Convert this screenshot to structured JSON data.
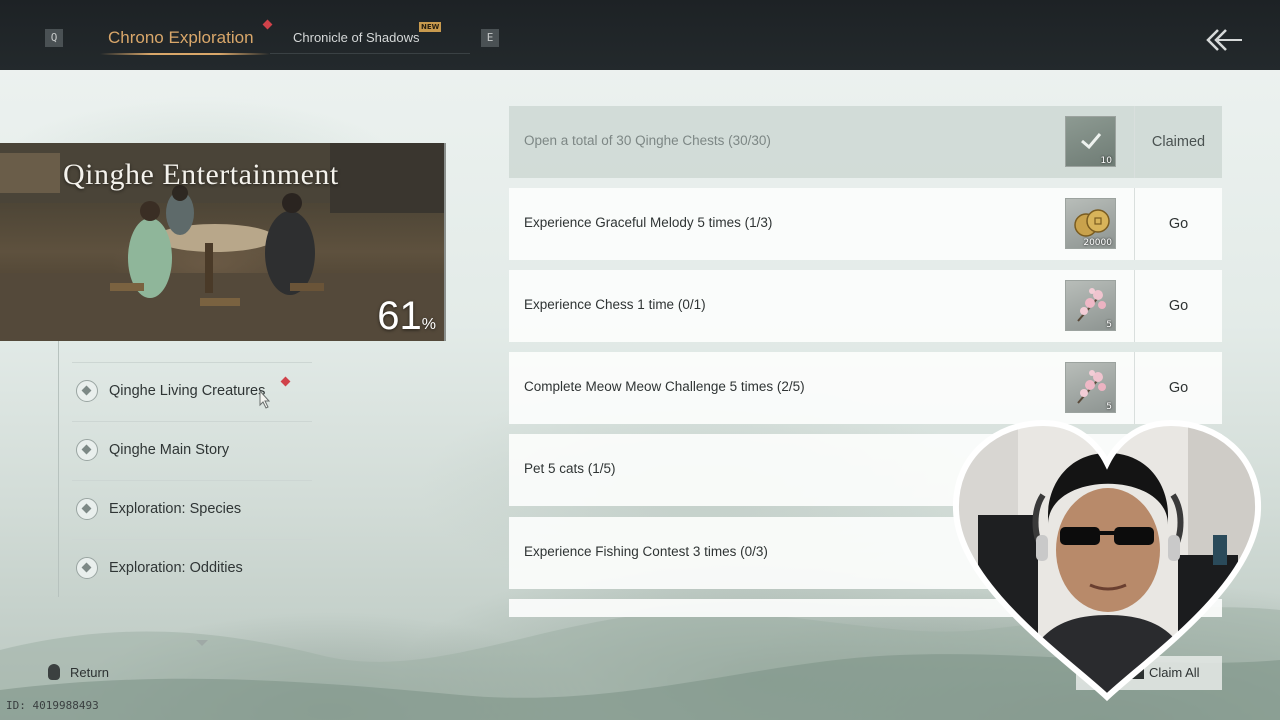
{
  "topbar": {
    "left_key": "Q",
    "right_key": "E",
    "tabs": [
      {
        "label": "Chrono Exploration",
        "active": true,
        "has_alert": true
      },
      {
        "label": "Chronicle of Shadows",
        "active": false,
        "badge": "NEW"
      }
    ],
    "back_icon": "double-chevron-back-icon"
  },
  "hero": {
    "title": "Qinghe Entertainment",
    "progress_value": "61",
    "progress_sign": "%"
  },
  "categories": [
    {
      "label": "Qinghe Living Creatures",
      "has_alert": true
    },
    {
      "label": "Qinghe Main Story",
      "has_alert": false
    },
    {
      "label": "Exploration: Species",
      "has_alert": false
    },
    {
      "label": "Exploration: Oddities",
      "has_alert": false
    }
  ],
  "tasks": [
    {
      "text": "Open a total of 30 Qinghe Chests (30/30)",
      "reward_icon": "checkmark-icon",
      "reward_qty": "10",
      "action": "Claimed",
      "state": "claimed"
    },
    {
      "text": "Experience Graceful Melody 5 times (1/3)",
      "reward_icon": "coins-icon",
      "reward_qty": "20000",
      "action": "Go",
      "state": "open"
    },
    {
      "text": "Experience Chess 1 time (0/1)",
      "reward_icon": "blossom-icon",
      "reward_qty": "5",
      "action": "Go",
      "state": "open"
    },
    {
      "text": "Complete Meow Meow Challenge 5 times (2/5)",
      "reward_icon": "blossom-icon",
      "reward_qty": "5",
      "action": "Go",
      "state": "open"
    },
    {
      "text": "Pet 5 cats (1/5)",
      "state": "open"
    },
    {
      "text": "Experience Fishing Contest 3 times (0/3)",
      "state": "open"
    }
  ],
  "footer": {
    "return_label": "Return",
    "claim_all_label": "Claim All",
    "id_text": "ID: 4019988493"
  },
  "colors": {
    "accent_gold": "#d9a76a",
    "alert_red": "#d0424a",
    "topbar_bg": "#1d2225"
  }
}
